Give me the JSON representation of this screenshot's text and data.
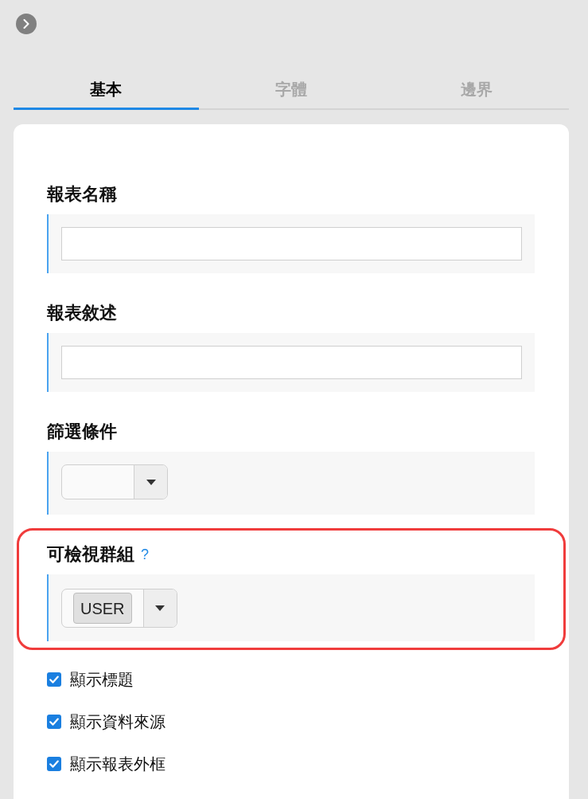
{
  "tabs": [
    {
      "label": "基本",
      "selected": true
    },
    {
      "label": "字體",
      "selected": false
    },
    {
      "label": "邊界",
      "selected": false
    }
  ],
  "fields": [
    {
      "kind": "text",
      "label": "報表名稱",
      "highlighted": false
    },
    {
      "kind": "text",
      "label": "報表敘述",
      "highlighted": false
    },
    {
      "kind": "select",
      "label": "篩選條件",
      "highlighted": false
    },
    {
      "kind": "select",
      "label": "可檢視群組",
      "help": "?",
      "tags": [
        "USER"
      ],
      "highlighted": true
    }
  ],
  "options": [
    {
      "label": "顯示標題",
      "checked": true
    },
    {
      "label": "顯示資料來源",
      "checked": true
    },
    {
      "label": "顯示報表外框",
      "checked": true
    }
  ]
}
